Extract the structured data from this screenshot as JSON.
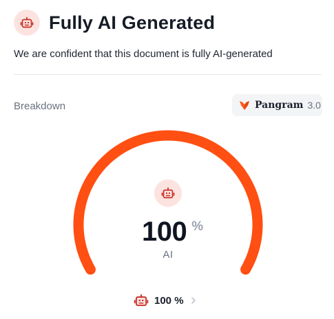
{
  "header": {
    "title": "Fully AI Generated",
    "icon": "robot-icon",
    "subtitle": "We are confident that this document is fully AI-generated"
  },
  "breakdown": {
    "label": "Breakdown",
    "brand": {
      "name": "Pangram",
      "version": "3.0",
      "icon": "pangram-logo-icon"
    }
  },
  "gauge": {
    "value": "100",
    "fraction": 1.0,
    "unit": "%",
    "caption": "AI",
    "icon": "robot-icon"
  },
  "summary": {
    "text": "100 %",
    "icon": "robot-icon",
    "chevron": "chevron-right-icon"
  },
  "colors": {
    "accent": "#ff4f12",
    "icon_bg": "#fde3e0",
    "icon_stroke": "#c62f26",
    "muted": "#6b7280",
    "pill_bg": "#f3f4f6"
  }
}
